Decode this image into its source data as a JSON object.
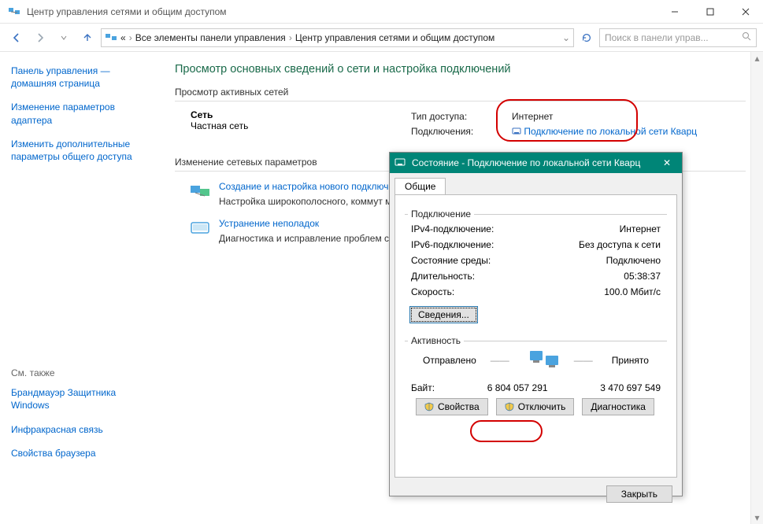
{
  "window": {
    "title": "Центр управления сетями и общим доступом"
  },
  "breadcrumb": {
    "root_short": "«",
    "item1": "Все элементы панели управления",
    "item2": "Центр управления сетями и общим доступом"
  },
  "search": {
    "placeholder": "Поиск в панели управ..."
  },
  "sidebar": {
    "l1": "Панель управления — домашняя страница",
    "l2": "Изменение параметров адаптера",
    "l3": "Изменить дополнительные параметры общего доступа",
    "see_also": "См. также",
    "sa1": "Брандмауэр Защитника Windows",
    "sa2": "Инфракрасная связь",
    "sa3": "Свойства браузера"
  },
  "content": {
    "heading": "Просмотр основных сведений о сети и настройка подключений",
    "g1": "Просмотр активных сетей",
    "net_name": "Сеть",
    "net_type": "Частная сеть",
    "k_access": "Тип доступа:",
    "v_access": "Интернет",
    "k_conn": "Подключения:",
    "v_conn": "Подключение по локальной сети Кварц",
    "g2": "Изменение сетевых параметров",
    "s1_link": "Создание и настройка нового подключ",
    "s1_desc": "Настройка широкополосного, коммут маршрутизатора или точки доступа.",
    "s2_link": "Устранение неполадок",
    "s2_desc": "Диагностика и исправление проблем с неполадок."
  },
  "dialog": {
    "title": "Состояние - Подключение по локальной сети Кварц",
    "tab": "Общие",
    "grp_conn": "Подключение",
    "rows": {
      "ipv4_k": "IPv4-подключение:",
      "ipv4_v": "Интернет",
      "ipv6_k": "IPv6-подключение:",
      "ipv6_v": "Без доступа к сети",
      "media_k": "Состояние среды:",
      "media_v": "Подключено",
      "dur_k": "Длительность:",
      "dur_v": "05:38:37",
      "spd_k": "Скорость:",
      "spd_v": "100.0 Мбит/с"
    },
    "details_btn": "Сведения...",
    "grp_act": "Активность",
    "sent": "Отправлено",
    "recv": "Принято",
    "bytes_label": "Байт:",
    "bytes_sent": "6 804 057 291",
    "bytes_recv": "3 470 697 549",
    "btn_props": "Свойства",
    "btn_disable": "Отключить",
    "btn_diag": "Диагностика",
    "btn_close": "Закрыть"
  }
}
